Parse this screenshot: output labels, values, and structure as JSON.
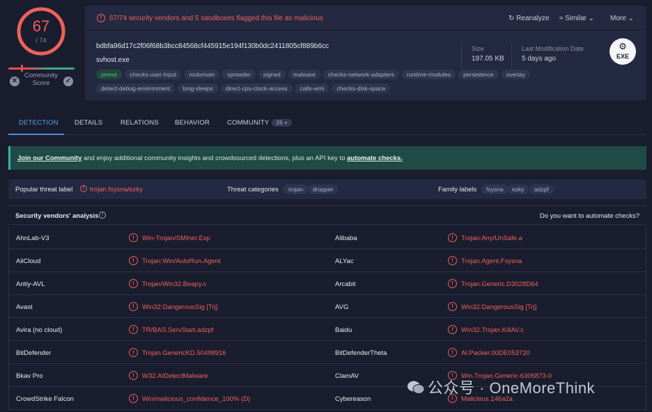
{
  "score": {
    "detected": "67",
    "total": "/ 74",
    "community_label": "Community\nScore",
    "dislike_icon": "x-icon",
    "like_icon": "check-icon"
  },
  "header": {
    "alert": "67/74 security vendors and 5 sandboxes flagged this file as malicious",
    "reanalyze": "Reanalyze",
    "similar": "Similar",
    "more": "More",
    "hash": "bdbfa96d17c2f06f68b3bcc84568cf445915e194f130b0dc2411805cf889b6cc",
    "filename": "svhost.exe",
    "tags": [
      "peexe",
      "checks-user-input",
      "nxdomain",
      "spreader",
      "signed",
      "malware",
      "checks-network-adapters",
      "runtime-modules",
      "persistence",
      "overlay",
      "detect-debug-environment",
      "long-sleeps",
      "direct-cpu-clock-access",
      "calls-wmi",
      "checks-disk-space"
    ],
    "size_label": "Size",
    "size_value": "197.05 KB",
    "modified_label": "Last Modification Date",
    "modified_value": "5 days ago",
    "filetype": "EXE"
  },
  "tabs": {
    "detection": "DETECTION",
    "details": "DETAILS",
    "relations": "RELATIONS",
    "behavior": "BEHAVIOR",
    "community": "COMMUNITY",
    "community_count": "26 +"
  },
  "banner": {
    "link1": "Join our Community",
    "middle": " and enjoy additional community insights and crowdsourced detections, plus an API key to ",
    "link2": "automate checks."
  },
  "threat": {
    "popular_label": "Popular threat label",
    "popular_value": "trojan.fsysna/ezky",
    "categories_label": "Threat categories",
    "categories": [
      "trojan",
      "dropper"
    ],
    "family_label": "Family labels",
    "families": [
      "fsysna",
      "ezky",
      "adzpf"
    ]
  },
  "vendors_head": {
    "title": "Security vendors' analysis",
    "automate": "Do you want to automate checks?"
  },
  "vendors": [
    [
      {
        "name": "AhnLab-V3",
        "result": "Win-Trojan/SMIner.Exp"
      },
      {
        "name": "Alibaba",
        "result": "Trojan:Any/UnSafe.a"
      }
    ],
    [
      {
        "name": "AliCloud",
        "result": "Trojan:Win/AutoRun.Agent"
      },
      {
        "name": "ALYac",
        "result": "Trojan.Agent.Fsysna"
      }
    ],
    [
      {
        "name": "Antiy-AVL",
        "result": "Trojan/Win32.Beapy.c"
      },
      {
        "name": "Arcabit",
        "result": "Trojan.Generic.D3028D64"
      }
    ],
    [
      {
        "name": "Avast",
        "result": "Win32:DangerousSig [Trj]"
      },
      {
        "name": "AVG",
        "result": "Win32:DangerousSig [Trj]"
      }
    ],
    [
      {
        "name": "Avira (no cloud)",
        "result": "TR/BAS.ServStart.adzpf"
      },
      {
        "name": "Baidu",
        "result": "Win32.Trojan.KillAV.c"
      }
    ],
    [
      {
        "name": "BitDefender",
        "result": "Trojan.GenericKD.50498916"
      },
      {
        "name": "BitDefenderTheta",
        "result": "AI:Packer.00DE053720"
      }
    ],
    [
      {
        "name": "Bkav Pro",
        "result": "W32.AIDetectMalware"
      },
      {
        "name": "ClamAV",
        "result": "Win.Trojan.Generic-6305873-0"
      }
    ],
    [
      {
        "name": "CrowdStrike Falcon",
        "result": "Win/malicious_confidence_100% (D)"
      },
      {
        "name": "Cybereason",
        "result": "Malicious.146a2a"
      }
    ]
  ],
  "watermark": "公众号 · OneMoreThink",
  "colors": {
    "malicious": "#f0615c",
    "accent": "#4a8fe0",
    "background": "#1a1d2e",
    "card": "#232940"
  }
}
